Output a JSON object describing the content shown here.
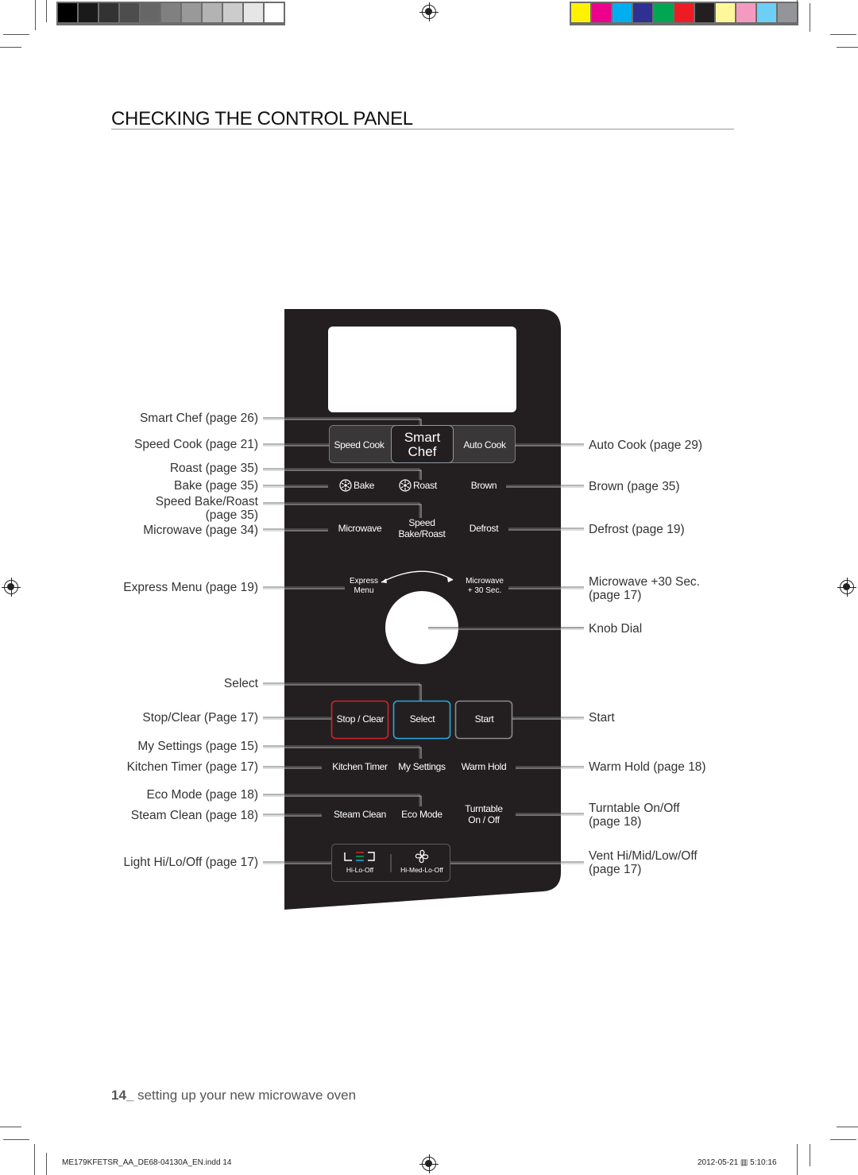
{
  "print_marks": {
    "gray_swatches": [
      "#000000",
      "#1a1a1a",
      "#333333",
      "#4d4d4d",
      "#666666",
      "#808080",
      "#999999",
      "#b3b3b3",
      "#cccccc",
      "#e6e6e6",
      "#ffffff"
    ],
    "color_swatches": [
      "#fff200",
      "#ec008c",
      "#00aeef",
      "#2e3192",
      "#00a651",
      "#ed1c24",
      "#231f20",
      "#fff799",
      "#f49ac1",
      "#6dcff6",
      "#939598"
    ]
  },
  "page": {
    "title": "CHECKING THE CONTROL PANEL",
    "footer_page_number": "14_",
    "footer_section": " setting up your new microwave oven",
    "meta_file": "ME179KFETSR_AA_DE68-04130A_EN.indd   14",
    "meta_date": "2012-05-21   ▥ 5:10:16"
  },
  "colors": {
    "panel_bg": "#231f20",
    "stop_border": "#d2232a",
    "select_border": "#27a9e1",
    "start_border": "#8a8a8a",
    "leader": "#6d6e71"
  },
  "panel": {
    "speed_cook": "Speed Cook",
    "smart_chef_line1": "Smart",
    "smart_chef_line2": "Chef",
    "auto_cook": "Auto Cook",
    "bake": "Bake",
    "roast": "Roast",
    "brown": "Brown",
    "microwave": "Microwave",
    "speed_bake_line1": "Speed",
    "speed_bake_line2": "Bake/Roast",
    "defrost": "Defrost",
    "express_line1": "Express",
    "express_line2": "Menu",
    "mw30_line1": "Microwave",
    "mw30_line2": "+ 30 Sec.",
    "stop_clear": "Stop / Clear",
    "select": "Select",
    "start": "Start",
    "kitchen_timer": "Kitchen Timer",
    "my_settings": "My Settings",
    "warm_hold": "Warm Hold",
    "steam_clean": "Steam Clean",
    "eco_mode": "Eco Mode",
    "turntable_line1": "Turntable",
    "turntable_line2": "On / Off",
    "light_sub": "Hi-Lo-Off",
    "vent_sub": "Hi-Med-Lo-Off"
  },
  "callouts_left": [
    {
      "id": "smart-chef",
      "text": "Smart Chef (page 26)"
    },
    {
      "id": "speed-cook",
      "text": "Speed Cook (page 21)"
    },
    {
      "id": "roast",
      "text": "Roast (page 35)"
    },
    {
      "id": "bake",
      "text": "Bake (page 35)"
    },
    {
      "id": "speed-bake-roast",
      "line1": "Speed Bake/Roast",
      "line2": "(page 35)"
    },
    {
      "id": "microwave",
      "text": "Microwave (page 34)"
    },
    {
      "id": "express-menu",
      "text": "Express Menu (page 19)"
    },
    {
      "id": "select",
      "text": "Select"
    },
    {
      "id": "stop-clear",
      "text": "Stop/Clear (Page 17)"
    },
    {
      "id": "my-settings",
      "text": "My Settings (page 15)"
    },
    {
      "id": "kitchen-timer",
      "text": "Kitchen Timer (page 17)"
    },
    {
      "id": "eco-mode",
      "text": "Eco Mode (page 18)"
    },
    {
      "id": "steam-clean",
      "text": "Steam Clean (page 18)"
    },
    {
      "id": "light",
      "text": "Light Hi/Lo/Off (page 17)"
    }
  ],
  "callouts_right": [
    {
      "id": "auto-cook",
      "text": "Auto Cook (page 29)"
    },
    {
      "id": "brown",
      "text": "Brown (page 35)"
    },
    {
      "id": "defrost",
      "text": "Defrost (page 19)"
    },
    {
      "id": "microwave-30",
      "line1": "Microwave +30 Sec.",
      "line2": "(page 17)"
    },
    {
      "id": "knob-dial",
      "text": "Knob Dial"
    },
    {
      "id": "start",
      "text": "Start"
    },
    {
      "id": "warm-hold",
      "text": "Warm Hold (page 18)"
    },
    {
      "id": "turntable",
      "line1": "Turntable On/Off",
      "line2": "(page 18)"
    },
    {
      "id": "vent",
      "line1": "Vent Hi/Mid/Low/Off",
      "line2": "(page 17)"
    }
  ]
}
